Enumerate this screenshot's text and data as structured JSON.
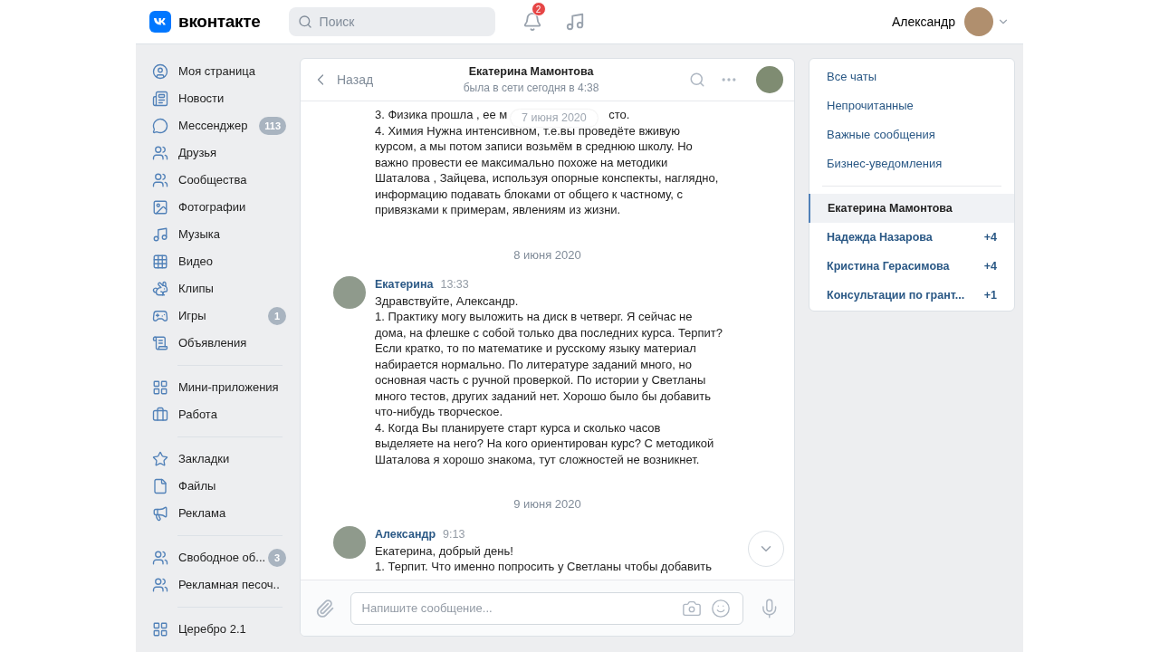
{
  "header": {
    "logo_text": "вконтакте",
    "search": {
      "placeholder": "Поиск"
    },
    "notifications_badge": "2",
    "user_name": "Александр"
  },
  "sidebar": {
    "groups": [
      [
        {
          "label": "Моя страница"
        },
        {
          "label": "Новости"
        },
        {
          "label": "Мессенджер",
          "badge": "113"
        },
        {
          "label": "Друзья"
        },
        {
          "label": "Сообщества"
        },
        {
          "label": "Фотографии"
        },
        {
          "label": "Музыка"
        },
        {
          "label": "Видео"
        },
        {
          "label": "Клипы"
        },
        {
          "label": "Игры",
          "badge": "1"
        },
        {
          "label": "Объявления"
        }
      ],
      [
        {
          "label": "Мини-приложения"
        },
        {
          "label": "Работа"
        }
      ],
      [
        {
          "label": "Закладки"
        },
        {
          "label": "Файлы"
        },
        {
          "label": "Реклама"
        }
      ],
      [
        {
          "label": "Свободное об...",
          "badge": "3"
        },
        {
          "label": "Рекламная песоч.."
        }
      ],
      [
        {
          "label": "Церебро 2.1"
        }
      ]
    ]
  },
  "chat": {
    "back": "Назад",
    "title": "Екатерина Мамонтова",
    "status": "была в сети сегодня в 4:38",
    "floating_date": "7 июня 2020",
    "items": [
      {
        "kind": "continuation",
        "split_line": [
          "3. Физика прошла , ее м",
          "сто."
        ],
        "lines": [
          "4. Химия Нужна интенсивном, т.е.вы проведёте вживую",
          "курсом, а мы потом записи возьмём в среднюю школу. Но",
          "важно провести ее максимально похоже на методики",
          "Шаталова , Зайцева, используя опорные конспекты, наглядно,",
          "информацию подавать блоками от общего к частному, с",
          "привязками к примерам, явлениям из жизни."
        ]
      },
      {
        "kind": "date",
        "text": "8 июня 2020"
      },
      {
        "kind": "message",
        "author": "Екатерина",
        "time": "13:33",
        "lines": [
          "Здравствуйте, Александр.",
          "1. Практику могу выложить на диск в четверг. Я сейчас не",
          "дома, на флешке с собой только два последних курса. Терпит?",
          "Если кратко, то по математике и русскому языку материал",
          "набирается нормально. По литературе заданий много, но",
          "основная часть с ручной проверкой. По истории у Светланы",
          "много тестов, других заданий нет. Хорошо было бы добавить",
          "что-нибудь творческое.",
          "4. Когда Вы планируете старт курса и сколько часов",
          "выделяете на него? На кого ориентирован курс? С методикой",
          "Шаталова я хорошо знакома, тут сложностей не возникнет."
        ]
      },
      {
        "kind": "date",
        "text": "9 июня 2020"
      },
      {
        "kind": "message",
        "author": "Александр",
        "time": "9:13",
        "lines": [
          "Екатерина, добрый день!",
          "1. Терпит. Что именно попросить у Светланы чтобы добавить"
        ]
      }
    ],
    "composer": {
      "placeholder": "Напишите сообщение..."
    }
  },
  "right_panel": {
    "filters": [
      {
        "label": "Все чаты"
      },
      {
        "label": "Непрочитанные"
      },
      {
        "label": "Важные сообщения"
      },
      {
        "label": "Бизнес-уведомления"
      }
    ],
    "chats": [
      {
        "name": "Екатерина Мамонтова",
        "selected": true
      },
      {
        "name": "Надежда Назарова",
        "count": "+4",
        "selected": false
      },
      {
        "name": "Кристина Герасимова",
        "count": "+4",
        "selected": false
      },
      {
        "name": "Консультации по грант...",
        "count": "+1",
        "selected": false
      }
    ]
  }
}
